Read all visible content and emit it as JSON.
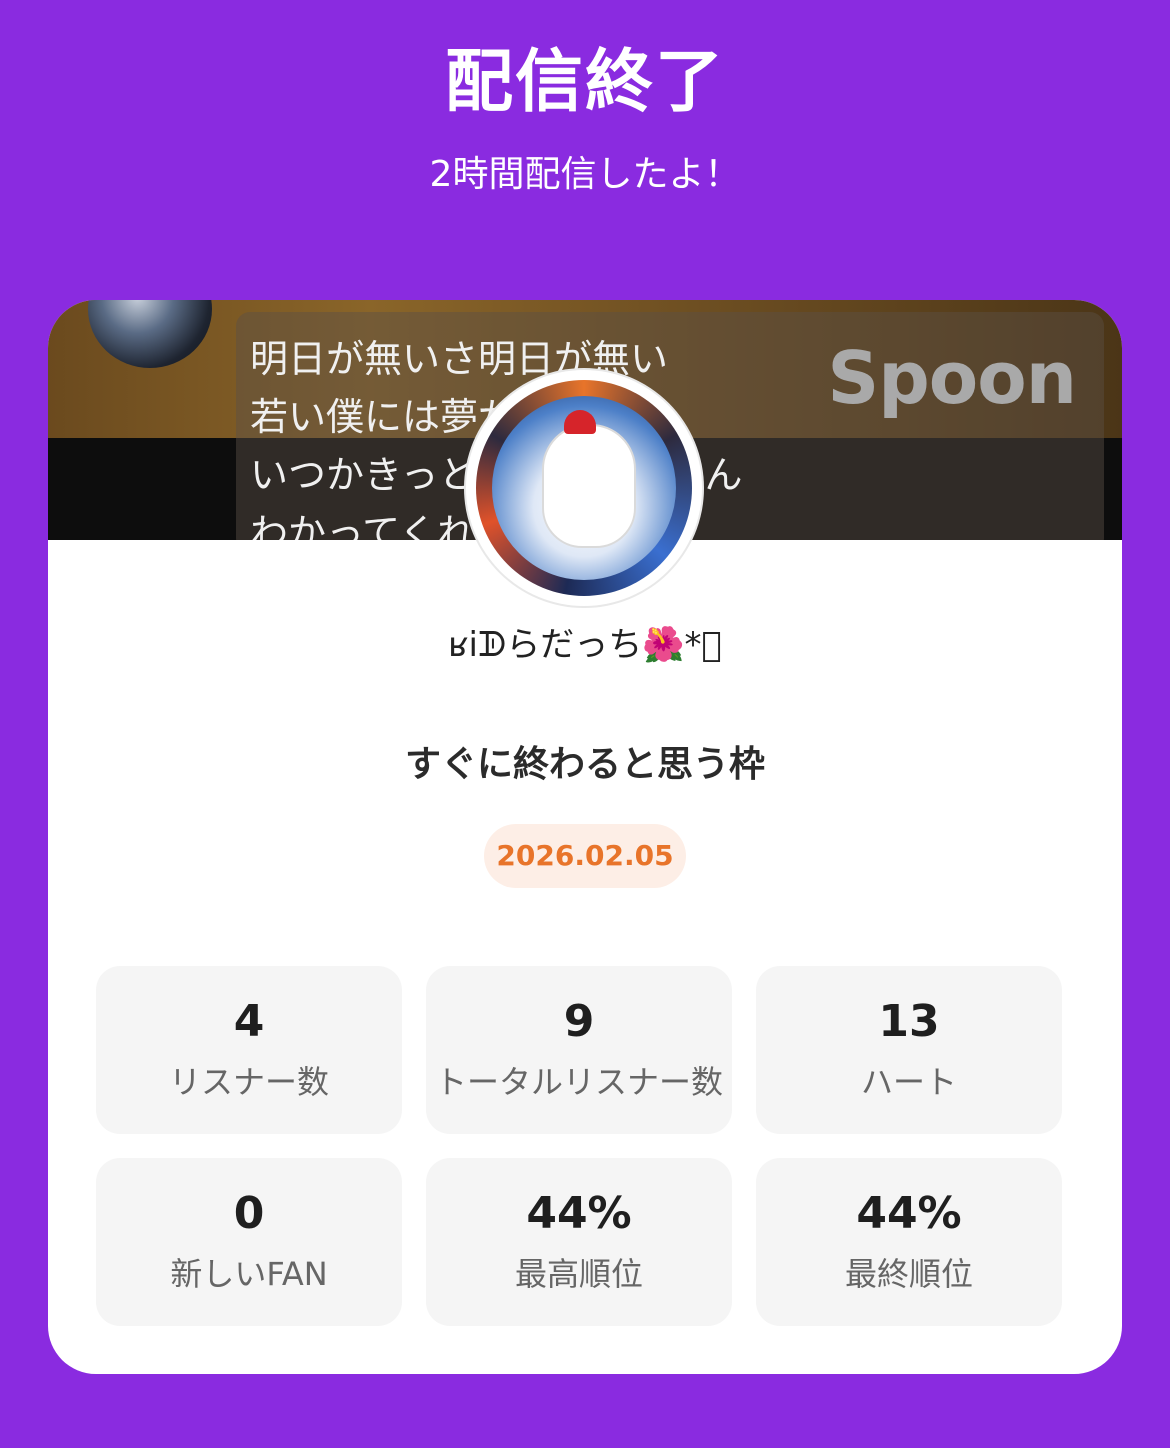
{
  "header": {
    "title": "配信終了",
    "subtitle": "2時間配信したよ！"
  },
  "banner": {
    "lyrics": "明日が無いさ明日が無い\n若い僕には夢が\nいつかきっと　　　になるん\nわかってくれ",
    "brand": "Spoon"
  },
  "profile": {
    "username": "ʁiᗫらだっち🌺*ﾟ",
    "avatar_icon": "rooster-avatar-icon"
  },
  "stream": {
    "title": "すぐに終わると思う枠",
    "date": "2026.02.05"
  },
  "stats": [
    {
      "value": "4",
      "label": "リスナー数"
    },
    {
      "value": "9",
      "label": "トータルリスナー数"
    },
    {
      "value": "13",
      "label": "ハート"
    },
    {
      "value": "0",
      "label": "新しいFAN"
    },
    {
      "value": "44%",
      "label": "最高順位"
    },
    {
      "value": "44%",
      "label": "最終順位"
    }
  ],
  "colors": {
    "background": "#8a2be0",
    "card": "#ffffff",
    "date_text": "#e8742a",
    "date_pill": "#fdeee6",
    "stat_tile": "#f5f5f5"
  }
}
